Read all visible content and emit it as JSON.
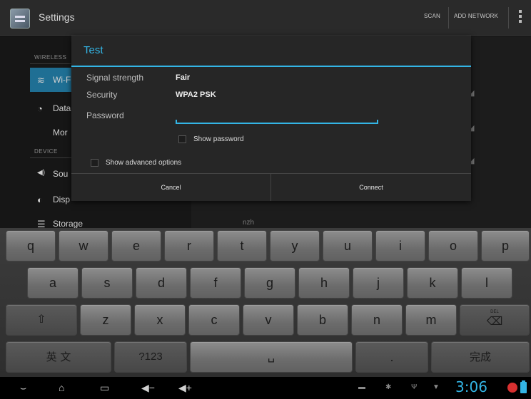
{
  "actionbar": {
    "title": "Settings",
    "scan_label": "SCAN",
    "add_network_label": "ADD NETWORK",
    "overflow_icon": "overflow-menu-icon"
  },
  "sidebar": {
    "wireless_header": "WIRELESS",
    "device_header": "DEVICE",
    "items": [
      {
        "label": "Wi-Fi",
        "icon": "wifi-icon",
        "glyph": "≋"
      },
      {
        "label": "Data",
        "icon": "data-usage-icon",
        "glyph": "◔"
      },
      {
        "label": "Mor",
        "icon": "",
        "glyph": ""
      },
      {
        "label": "Sou",
        "icon": "sound-icon",
        "glyph": "◀)"
      },
      {
        "label": "Disp",
        "icon": "display-icon",
        "glyph": "◐"
      },
      {
        "label": "Storage",
        "icon": "storage-icon",
        "glyph": "☰"
      }
    ]
  },
  "background": {
    "network_label": "nzh"
  },
  "dialog": {
    "title": "Test",
    "signal_label": "Signal strength",
    "signal_value": "Fair",
    "security_label": "Security",
    "security_value": "WPA2 PSK",
    "password_label": "Password",
    "password_value": "",
    "show_password_label": "Show password",
    "show_advanced_label": "Show advanced options",
    "cancel_label": "Cancel",
    "connect_label": "Connect"
  },
  "keyboard": {
    "row1": [
      "q",
      "w",
      "e",
      "r",
      "t",
      "y",
      "u",
      "i",
      "o",
      "p"
    ],
    "row2": [
      "a",
      "s",
      "d",
      "f",
      "g",
      "h",
      "j",
      "k",
      "l"
    ],
    "row3": [
      "⇧",
      "z",
      "x",
      "c",
      "v",
      "b",
      "n",
      "m",
      "⌫"
    ],
    "row4": [
      "英 文",
      "?123",
      "␣",
      ".",
      "完成"
    ],
    "del_sub": "DEL"
  },
  "status": {
    "time": "3:06"
  },
  "colors": {
    "accent": "#33b5e5",
    "selected_nav": "#1f6f94",
    "dialog_bg": "#262626"
  }
}
